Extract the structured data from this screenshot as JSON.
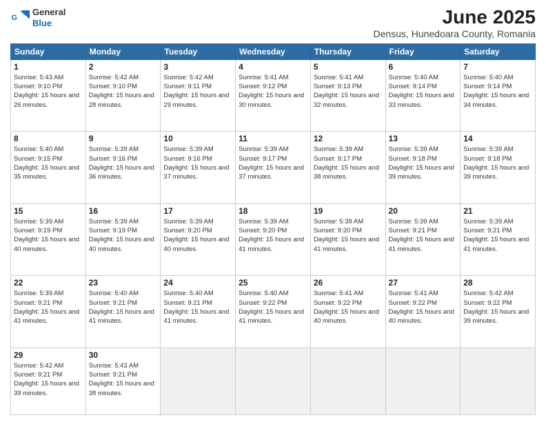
{
  "logo": {
    "line1": "General",
    "line2": "Blue"
  },
  "title": "June 2025",
  "subtitle": "Densus, Hunedoara County, Romania",
  "headers": [
    "Sunday",
    "Monday",
    "Tuesday",
    "Wednesday",
    "Thursday",
    "Friday",
    "Saturday"
  ],
  "weeks": [
    [
      {
        "day": "1",
        "rise": "5:43 AM",
        "set": "9:10 PM",
        "daylight": "15 hours and 26 minutes."
      },
      {
        "day": "2",
        "rise": "5:42 AM",
        "set": "9:10 PM",
        "daylight": "15 hours and 28 minutes."
      },
      {
        "day": "3",
        "rise": "5:42 AM",
        "set": "9:11 PM",
        "daylight": "15 hours and 29 minutes."
      },
      {
        "day": "4",
        "rise": "5:41 AM",
        "set": "9:12 PM",
        "daylight": "15 hours and 30 minutes."
      },
      {
        "day": "5",
        "rise": "5:41 AM",
        "set": "9:13 PM",
        "daylight": "15 hours and 32 minutes."
      },
      {
        "day": "6",
        "rise": "5:40 AM",
        "set": "9:14 PM",
        "daylight": "15 hours and 33 minutes."
      },
      {
        "day": "7",
        "rise": "5:40 AM",
        "set": "9:14 PM",
        "daylight": "15 hours and 34 minutes."
      }
    ],
    [
      {
        "day": "8",
        "rise": "5:40 AM",
        "set": "9:15 PM",
        "daylight": "15 hours and 35 minutes."
      },
      {
        "day": "9",
        "rise": "5:39 AM",
        "set": "9:16 PM",
        "daylight": "15 hours and 36 minutes."
      },
      {
        "day": "10",
        "rise": "5:39 AM",
        "set": "9:16 PM",
        "daylight": "15 hours and 37 minutes."
      },
      {
        "day": "11",
        "rise": "5:39 AM",
        "set": "9:17 PM",
        "daylight": "15 hours and 37 minutes."
      },
      {
        "day": "12",
        "rise": "5:39 AM",
        "set": "9:17 PM",
        "daylight": "15 hours and 38 minutes."
      },
      {
        "day": "13",
        "rise": "5:39 AM",
        "set": "9:18 PM",
        "daylight": "15 hours and 39 minutes."
      },
      {
        "day": "14",
        "rise": "5:39 AM",
        "set": "9:18 PM",
        "daylight": "15 hours and 39 minutes."
      }
    ],
    [
      {
        "day": "15",
        "rise": "5:39 AM",
        "set": "9:19 PM",
        "daylight": "15 hours and 40 minutes."
      },
      {
        "day": "16",
        "rise": "5:39 AM",
        "set": "9:19 PM",
        "daylight": "15 hours and 40 minutes."
      },
      {
        "day": "17",
        "rise": "5:39 AM",
        "set": "9:20 PM",
        "daylight": "15 hours and 40 minutes."
      },
      {
        "day": "18",
        "rise": "5:39 AM",
        "set": "9:20 PM",
        "daylight": "15 hours and 41 minutes."
      },
      {
        "day": "19",
        "rise": "5:39 AM",
        "set": "9:20 PM",
        "daylight": "15 hours and 41 minutes."
      },
      {
        "day": "20",
        "rise": "5:39 AM",
        "set": "9:21 PM",
        "daylight": "15 hours and 41 minutes."
      },
      {
        "day": "21",
        "rise": "5:39 AM",
        "set": "9:21 PM",
        "daylight": "15 hours and 41 minutes."
      }
    ],
    [
      {
        "day": "22",
        "rise": "5:39 AM",
        "set": "9:21 PM",
        "daylight": "15 hours and 41 minutes."
      },
      {
        "day": "23",
        "rise": "5:40 AM",
        "set": "9:21 PM",
        "daylight": "15 hours and 41 minutes."
      },
      {
        "day": "24",
        "rise": "5:40 AM",
        "set": "9:21 PM",
        "daylight": "15 hours and 41 minutes."
      },
      {
        "day": "25",
        "rise": "5:40 AM",
        "set": "9:22 PM",
        "daylight": "15 hours and 41 minutes."
      },
      {
        "day": "26",
        "rise": "5:41 AM",
        "set": "9:22 PM",
        "daylight": "15 hours and 40 minutes."
      },
      {
        "day": "27",
        "rise": "5:41 AM",
        "set": "9:22 PM",
        "daylight": "15 hours and 40 minutes."
      },
      {
        "day": "28",
        "rise": "5:42 AM",
        "set": "9:22 PM",
        "daylight": "15 hours and 39 minutes."
      }
    ],
    [
      {
        "day": "29",
        "rise": "5:42 AM",
        "set": "9:21 PM",
        "daylight": "15 hours and 39 minutes."
      },
      {
        "day": "30",
        "rise": "5:43 AM",
        "set": "9:21 PM",
        "daylight": "15 hours and 38 minutes."
      },
      null,
      null,
      null,
      null,
      null
    ]
  ],
  "labels": {
    "sunrise": "Sunrise:",
    "sunset": "Sunset:",
    "daylight": "Daylight:"
  }
}
